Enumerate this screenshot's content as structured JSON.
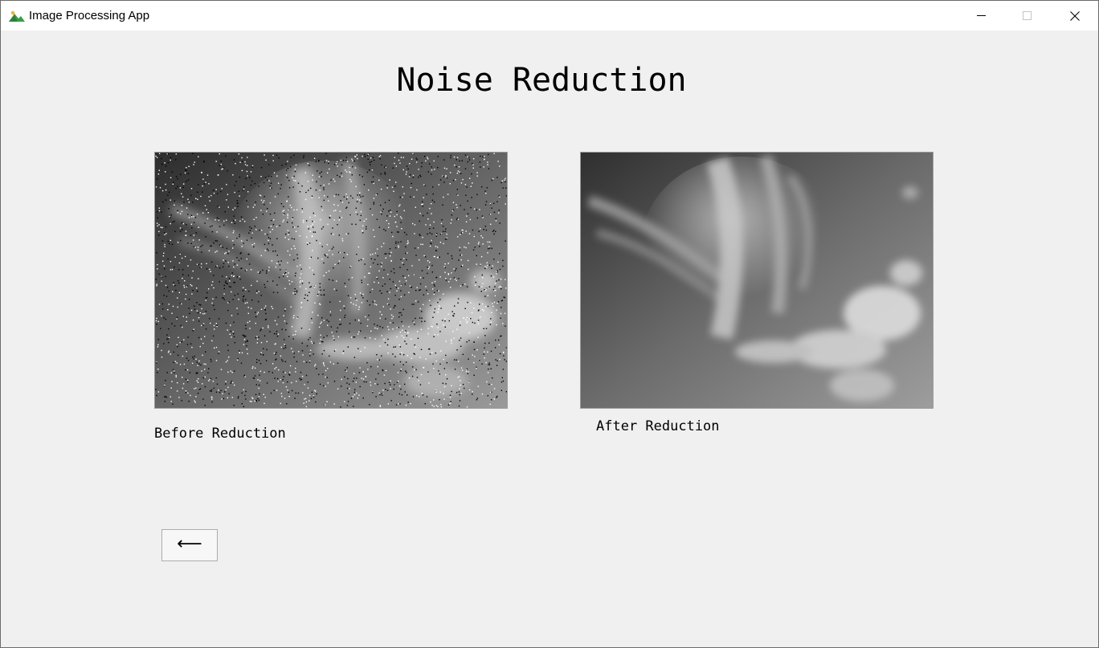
{
  "window": {
    "title": "Image Processing App",
    "app_icon": "landscape-icon",
    "controls": {
      "minimize_icon": "minimize-icon",
      "maximize_icon": "maximize-icon",
      "close_icon": "close-icon"
    }
  },
  "page": {
    "heading": "Noise Reduction",
    "before_caption": "Before Reduction",
    "after_caption": "After Reduction",
    "back_button_label": "⟵",
    "back_button_icon": "arrow-left-icon"
  },
  "colors": {
    "background": "#f0f0f0",
    "titlebar": "#ffffff",
    "icon_green": "#3a9d4a"
  }
}
